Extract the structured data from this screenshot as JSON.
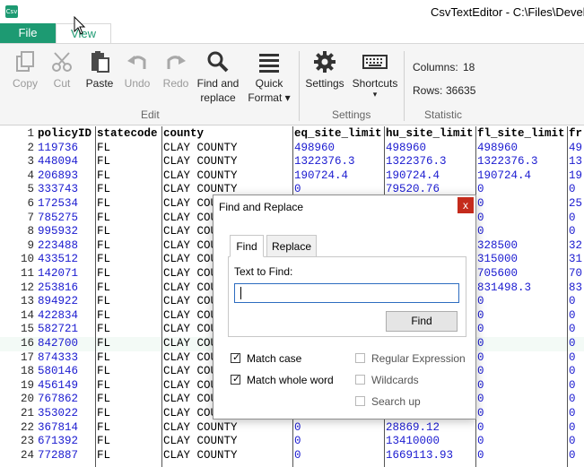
{
  "window": {
    "app_icon_text": "Csv",
    "title": "CsvTextEditor - C:\\Files\\Develo"
  },
  "tabs": {
    "file": "File",
    "view": "View"
  },
  "ribbon": {
    "edit": {
      "copy": "Copy",
      "cut": "Cut",
      "paste": "Paste",
      "undo": "Undo",
      "redo": "Redo",
      "find_replace_line1": "Find and",
      "find_replace_line2": "replace",
      "quick_format_line1": "Quick",
      "quick_format_line2": "Format ▾",
      "group": "Edit"
    },
    "settings": {
      "settings": "Settings",
      "shortcuts": "Shortcuts",
      "shortcuts_arrow": "▾",
      "group": "Settings"
    },
    "statistic": {
      "columns_label": "Columns:",
      "columns_value": "18",
      "rows_label": "Rows:",
      "rows_value": "36635",
      "group": "Statistic"
    }
  },
  "grid": {
    "headers": [
      "policyID",
      "statecode",
      "county",
      "eq_site_limit",
      "hu_site_limit",
      "fl_site_limit",
      "fr"
    ],
    "rows": [
      [
        "119736",
        "FL",
        "CLAY COUNTY",
        "498960",
        "498960",
        "498960",
        "49"
      ],
      [
        "448094",
        "FL",
        "CLAY COUNTY",
        "1322376.3",
        "1322376.3",
        "1322376.3",
        "13"
      ],
      [
        "206893",
        "FL",
        "CLAY COUNTY",
        "190724.4",
        "190724.4",
        "190724.4",
        "19"
      ],
      [
        "333743",
        "FL",
        "CLAY COUNTY",
        "0",
        "79520.76",
        "0",
        "0"
      ],
      [
        "172534",
        "FL",
        "CLAY COU",
        "",
        "",
        "0",
        "25"
      ],
      [
        "785275",
        "FL",
        "CLAY COU",
        "",
        "",
        "0",
        "0"
      ],
      [
        "995932",
        "FL",
        "CLAY COU",
        "",
        "",
        "0",
        "0"
      ],
      [
        "223488",
        "FL",
        "CLAY COU",
        "",
        "",
        "328500",
        "32"
      ],
      [
        "433512",
        "FL",
        "CLAY COU",
        "",
        "",
        "315000",
        "31"
      ],
      [
        "142071",
        "FL",
        "CLAY COU",
        "",
        "",
        "705600",
        "70"
      ],
      [
        "253816",
        "FL",
        "CLAY COU",
        "",
        "",
        "831498.3",
        "83"
      ],
      [
        "894922",
        "FL",
        "CLAY COU",
        "",
        "",
        "0",
        "0"
      ],
      [
        "422834",
        "FL",
        "CLAY COU",
        "",
        "",
        "0",
        "0"
      ],
      [
        "582721",
        "FL",
        "CLAY COU",
        "",
        "",
        "0",
        "0"
      ],
      [
        "842700",
        "FL",
        "CLAY COU",
        "",
        "",
        "0",
        "0"
      ],
      [
        "874333",
        "FL",
        "CLAY COU",
        "",
        "",
        "0",
        "0"
      ],
      [
        "580146",
        "FL",
        "CLAY COU",
        "",
        "",
        "0",
        "0"
      ],
      [
        "456149",
        "FL",
        "CLAY COU",
        "",
        "",
        "0",
        "0"
      ],
      [
        "767862",
        "FL",
        "CLAY COU",
        "",
        "",
        "0",
        "0"
      ],
      [
        "353022",
        "FL",
        "CLAY COU",
        "",
        "",
        "0",
        "0"
      ],
      [
        "367814",
        "FL",
        "CLAY COUNTY",
        "0",
        "28869.12",
        "0",
        "0"
      ],
      [
        "671392",
        "FL",
        "CLAY COUNTY",
        "0",
        "13410000",
        "0",
        "0"
      ],
      [
        "772887",
        "FL",
        "CLAY COUNTY",
        "0",
        "1669113.93",
        "0",
        "0"
      ]
    ]
  },
  "dialog": {
    "title": "Find and Replace",
    "close": "x",
    "tab_find": "Find",
    "tab_replace": "Replace",
    "text_to_find_label": "Text to Find:",
    "find_value": "",
    "find_button": "Find",
    "match_case": "Match case",
    "match_whole_word": "Match whole word",
    "regular_expression": "Regular Expression",
    "wildcards": "Wildcards",
    "search_up": "Search up",
    "match_case_checked": true,
    "match_whole_word_checked": true
  },
  "colors": {
    "accent": "#1d9a72",
    "number_text": "#1a1ad0",
    "close_button": "#c42b1c"
  }
}
